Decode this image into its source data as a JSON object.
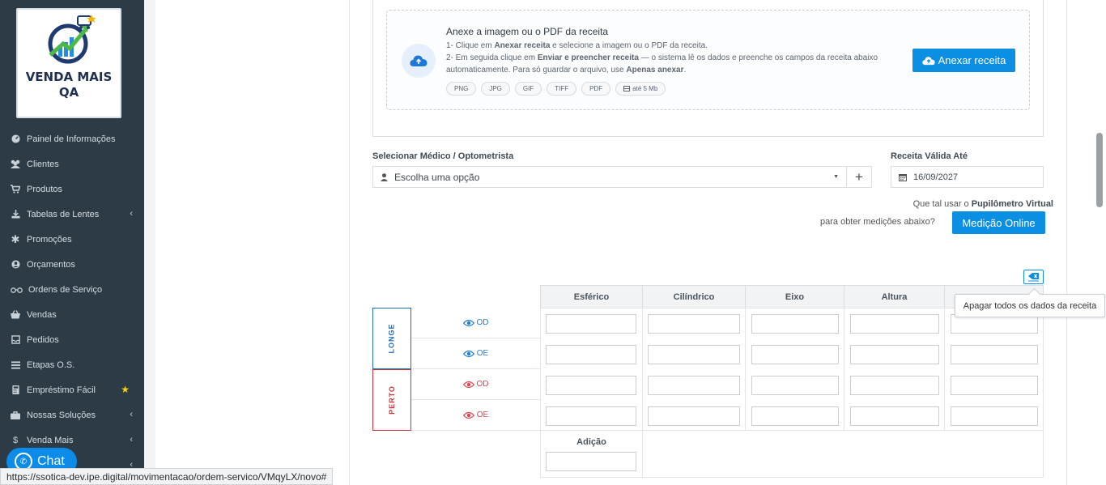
{
  "sidebar": {
    "logo_line1": "VENDA MAIS",
    "logo_line2": "QA",
    "items": [
      {
        "label": "Painel de Informações",
        "icon": "dashboard-icon"
      },
      {
        "label": "Clientes",
        "icon": "users-icon"
      },
      {
        "label": "Produtos",
        "icon": "cart-icon"
      },
      {
        "label": "Tabelas de Lentes",
        "icon": "download-icon",
        "has_arrow": true
      },
      {
        "label": "Promoções",
        "icon": "asterisk-icon"
      },
      {
        "label": "Orçamentos",
        "icon": "user-circle-icon"
      },
      {
        "label": "Ordens de Serviço",
        "icon": "glasses-icon"
      },
      {
        "label": "Vendas",
        "icon": "basket-icon"
      },
      {
        "label": "Pedidos",
        "icon": "inbox-icon"
      },
      {
        "label": "Etapas O.S.",
        "icon": "list-icon"
      },
      {
        "label": "Empréstimo Fácil",
        "icon": "calculator-icon",
        "has_star": true
      },
      {
        "label": "Nossas Soluções",
        "icon": "briefcase-icon",
        "has_arrow": true
      },
      {
        "label": "Venda Mais",
        "icon": "dollar-icon",
        "has_arrow": true
      }
    ],
    "chat_label": "Chat"
  },
  "status_url": "https://ssotica-dev.ipe.digital/movimentacao/ordem-servico/VMqyLX/novo#",
  "upload": {
    "title": "Anexe a imagem ou o PDF da receita",
    "line1_a": "1- Clique em ",
    "line1_b": "Anexar receita",
    "line1_c": " e selecione a imagem ou o PDF da receita.",
    "line2_a": "2- Em seguida clique em ",
    "line2_b": "Enviar e preencher receita",
    "line2_c": " — o sistema lê os dados e preenche os campos da receita abaixo",
    "line3_a": "automaticamente. Para só guardar o arquivo, use ",
    "line3_b": "Apenas anexar",
    "line3_c": ".",
    "chips": [
      "PNG",
      "JPG",
      "GIF",
      "TIFF",
      "PDF",
      "até 5 Mb"
    ],
    "button": "Anexar receita"
  },
  "doctor": {
    "label": "Selecionar Médico / Optometrista",
    "placeholder": "Escolha uma opção"
  },
  "validity": {
    "label": "Receita Válida Até",
    "value": "16/09/2027"
  },
  "pupilometer": {
    "text_a": "Que tal usar o ",
    "text_b": "Pupilômetro Virtual",
    "text_c": "para obter medições abaixo?",
    "button": "Medição Online"
  },
  "eraser_tooltip": "Apagar todos os dados da receita",
  "table": {
    "columns": [
      "Esférico",
      "Cilíndrico",
      "Eixo",
      "Altura",
      ""
    ],
    "groups": [
      {
        "label": "LONGE",
        "color": "#1f6fb8"
      },
      {
        "label": "PERTO",
        "color": "#d6303a"
      }
    ],
    "rows": [
      {
        "eye": "OD",
        "color": "#1f7fd6"
      },
      {
        "eye": "OE",
        "color": "#1f7fd6"
      },
      {
        "eye": "OD",
        "color": "#e0454f"
      },
      {
        "eye": "OE",
        "color": "#e0454f"
      }
    ],
    "adicao_label": "Adição"
  },
  "colors": {
    "sidebar_bg": "#2c3b46",
    "primary": "#0b8fe3",
    "longe": "#1f6fb8",
    "perto": "#d6303a"
  }
}
